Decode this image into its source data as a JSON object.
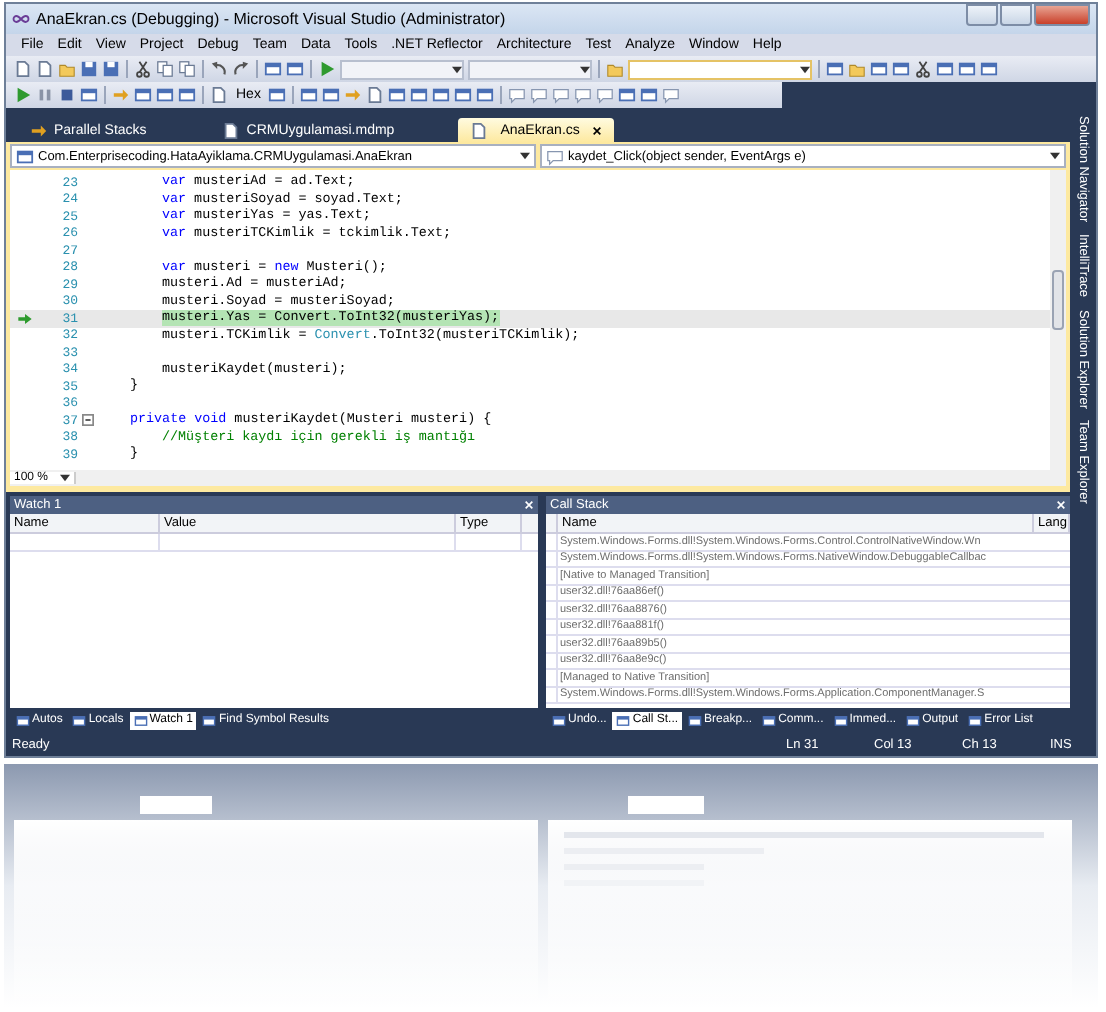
{
  "window": {
    "title": "AnaEkran.cs (Debugging) - Microsoft Visual Studio (Administrator)"
  },
  "menu": [
    "File",
    "Edit",
    "View",
    "Project",
    "Debug",
    "Team",
    "Data",
    "Tools",
    ".NET Reflector",
    "Architecture",
    "Test",
    "Analyze",
    "Window",
    "Help"
  ],
  "toolbar": {
    "hex_label": "Hex"
  },
  "document_tabs": [
    {
      "label": "Parallel Stacks",
      "selected": false
    },
    {
      "label": "CRMUygulamasi.mdmp",
      "selected": false
    },
    {
      "label": "AnaEkran.cs",
      "selected": true
    }
  ],
  "navigation": {
    "type_scope": "Com.Enterprisecoding.HataAyiklama.CRMUygulamasi.AnaEkran",
    "member": "kaydet_Click(object sender, EventArgs e)"
  },
  "editor": {
    "zoom": "100 %",
    "lines": [
      {
        "number": "23",
        "current": false,
        "collapsible": false,
        "kind": "body",
        "tokens": [
          {
            "kind": "keyword",
            "text": "var"
          },
          {
            "kind": "plain",
            "text": " musteriAd = ad.Text;"
          }
        ]
      },
      {
        "number": "24",
        "current": false,
        "collapsible": false,
        "kind": "body",
        "tokens": [
          {
            "kind": "keyword",
            "text": "var"
          },
          {
            "kind": "plain",
            "text": " musteriSoyad = soyad.Text;"
          }
        ]
      },
      {
        "number": "25",
        "current": false,
        "collapsible": false,
        "kind": "body",
        "tokens": [
          {
            "kind": "keyword",
            "text": "var"
          },
          {
            "kind": "plain",
            "text": " musteriYas = yas.Text;"
          }
        ]
      },
      {
        "number": "26",
        "current": false,
        "collapsible": false,
        "kind": "body",
        "tokens": [
          {
            "kind": "keyword",
            "text": "var"
          },
          {
            "kind": "plain",
            "text": " musteriTCKimlik = tckimlik.Text;"
          }
        ]
      },
      {
        "number": "27",
        "current": false,
        "collapsible": false,
        "kind": "blank"
      },
      {
        "number": "28",
        "current": false,
        "collapsible": false,
        "kind": "body",
        "tokens": [
          {
            "kind": "keyword",
            "text": "var"
          },
          {
            "kind": "plain",
            "text": " musteri = "
          },
          {
            "kind": "keyword",
            "text": "new"
          },
          {
            "kind": "plain",
            "text": " Musteri();"
          }
        ]
      },
      {
        "number": "29",
        "current": false,
        "collapsible": false,
        "kind": "body",
        "tokens": [
          {
            "kind": "plain",
            "text": "musteri.Ad = musteriAd;"
          }
        ]
      },
      {
        "number": "30",
        "current": false,
        "collapsible": false,
        "kind": "body",
        "tokens": [
          {
            "kind": "plain",
            "text": "musteri.Soyad = musteriSoyad;"
          }
        ]
      },
      {
        "number": "31",
        "current": true,
        "collapsible": false,
        "kind": "body",
        "tokens": [
          {
            "kind": "statement",
            "text": "musteri.Yas = Convert.ToInt32(musteriYas);"
          }
        ]
      },
      {
        "number": "32",
        "current": false,
        "collapsible": false,
        "kind": "body",
        "tokens": [
          {
            "kind": "plain",
            "text": "musteri.TCKimlik = "
          },
          {
            "kind": "type",
            "text": "Convert"
          },
          {
            "kind": "plain",
            "text": ".ToInt32(musteriTCKimlik);"
          }
        ]
      },
      {
        "number": "33",
        "current": false,
        "collapsible": false,
        "kind": "blank"
      },
      {
        "number": "34",
        "current": false,
        "collapsible": false,
        "kind": "body",
        "tokens": [
          {
            "kind": "plain",
            "text": "musteriKaydet(musteri);"
          }
        ]
      },
      {
        "number": "35",
        "current": false,
        "collapsible": false,
        "kind": "member",
        "tokens": [
          {
            "kind": "plain",
            "text": "}"
          }
        ]
      },
      {
        "number": "36",
        "current": false,
        "collapsible": false,
        "kind": "blank"
      },
      {
        "number": "37",
        "current": false,
        "collapsible": true,
        "kind": "member",
        "tokens": [
          {
            "kind": "keyword",
            "text": "private void"
          },
          {
            "kind": "plain",
            "text": " musteriKaydet(Musteri musteri) {"
          }
        ]
      },
      {
        "number": "38",
        "current": false,
        "collapsible": false,
        "kind": "body",
        "tokens": [
          {
            "kind": "comment",
            "text": "//Müşteri kaydı için gerekli iş mantığı"
          }
        ]
      },
      {
        "number": "39",
        "current": false,
        "collapsible": false,
        "kind": "member",
        "tokens": [
          {
            "kind": "plain",
            "text": "}"
          }
        ]
      }
    ]
  },
  "side_tabs": [
    "Solution Navigator",
    "IntelliTrace",
    "Solution Explorer",
    "Team Explorer"
  ],
  "watch": {
    "title": "Watch 1",
    "columns": [
      "Name",
      "Value",
      "Type"
    ],
    "tabs": [
      {
        "label": "Autos",
        "selected": false
      },
      {
        "label": "Locals",
        "selected": false
      },
      {
        "label": "Watch 1",
        "selected": true
      },
      {
        "label": "Find Symbol Results",
        "selected": false
      }
    ]
  },
  "call_stack": {
    "title": "Call Stack",
    "columns": [
      "Name",
      "Lang"
    ],
    "rows": [
      "System.Windows.Forms.dll!System.Windows.Forms.Control.ControlNativeWindow.Wn",
      "System.Windows.Forms.dll!System.Windows.Forms.NativeWindow.DebuggableCallbac",
      "[Native to Managed Transition]",
      "user32.dll!76aa86ef()",
      "user32.dll!76aa8876()",
      "user32.dll!76aa881f()",
      "user32.dll!76aa89b5()",
      "user32.dll!76aa8e9c()",
      "[Managed to Native Transition]",
      "System.Windows.Forms.dll!System.Windows.Forms.Application.ComponentManager.S"
    ],
    "tabs": [
      {
        "label": "Undo...",
        "selected": false
      },
      {
        "label": "Call St...",
        "selected": true
      },
      {
        "label": "Breakp...",
        "selected": false
      },
      {
        "label": "Comm...",
        "selected": false
      },
      {
        "label": "Immed...",
        "selected": false
      },
      {
        "label": "Output",
        "selected": false
      },
      {
        "label": "Error List",
        "selected": false
      }
    ]
  },
  "status_bar": {
    "message": "Ready",
    "line": "Ln 31",
    "column": "Col 13",
    "char": "Ch 13",
    "mode": "INS"
  }
}
